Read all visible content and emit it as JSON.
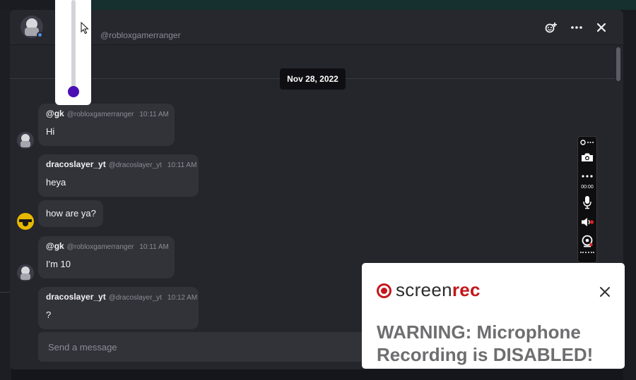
{
  "chat": {
    "header_handle": "@robloxgamerranger",
    "date_divider": "Nov 28, 2022",
    "composer_placeholder": "Send a message",
    "messages": [
      {
        "author": "@gk",
        "handle": "@robloxgamerranger",
        "time": "10:11 AM",
        "text": "Hi",
        "avatar": "gk-avatar"
      },
      {
        "author": "dracoslayer_yt",
        "handle": "@dracoslayer_yt",
        "time": "10:11 AM",
        "text": "heya",
        "avatar": "dracoslayer-avatar"
      },
      {
        "author": "",
        "handle": "",
        "time": "",
        "text": "how are ya?",
        "avatar": "dracoslayer-avatar"
      },
      {
        "author": "@gk",
        "handle": "@robloxgamerranger",
        "time": "10:11 AM",
        "text": "I'm 10",
        "avatar": "gk-avatar"
      },
      {
        "author": "dracoslayer_yt",
        "handle": "@dracoslayer_yt",
        "time": "10:12 AM",
        "text": "?",
        "avatar": "dracoslayer-avatar"
      }
    ]
  },
  "icons": {
    "header": [
      "add-friend-icon",
      "more-icon",
      "close-icon"
    ],
    "toolbar": [
      "settings-icon",
      "camera-icon",
      "more-icon",
      "microphone-icon",
      "speaker-icon",
      "webcam-icon"
    ]
  },
  "volume": {
    "level": 0.02
  },
  "recorder": {
    "timer": "00:00",
    "brand_part1": "screen",
    "brand_part2": "rec",
    "warning": "WARNING: Microphone Recording is DISABLED!"
  },
  "colors": {
    "brand_red": "#c4161c",
    "slider_knob": "#4b0fb3",
    "window_bg": "#25252c",
    "bubble_bg": "#323239"
  }
}
